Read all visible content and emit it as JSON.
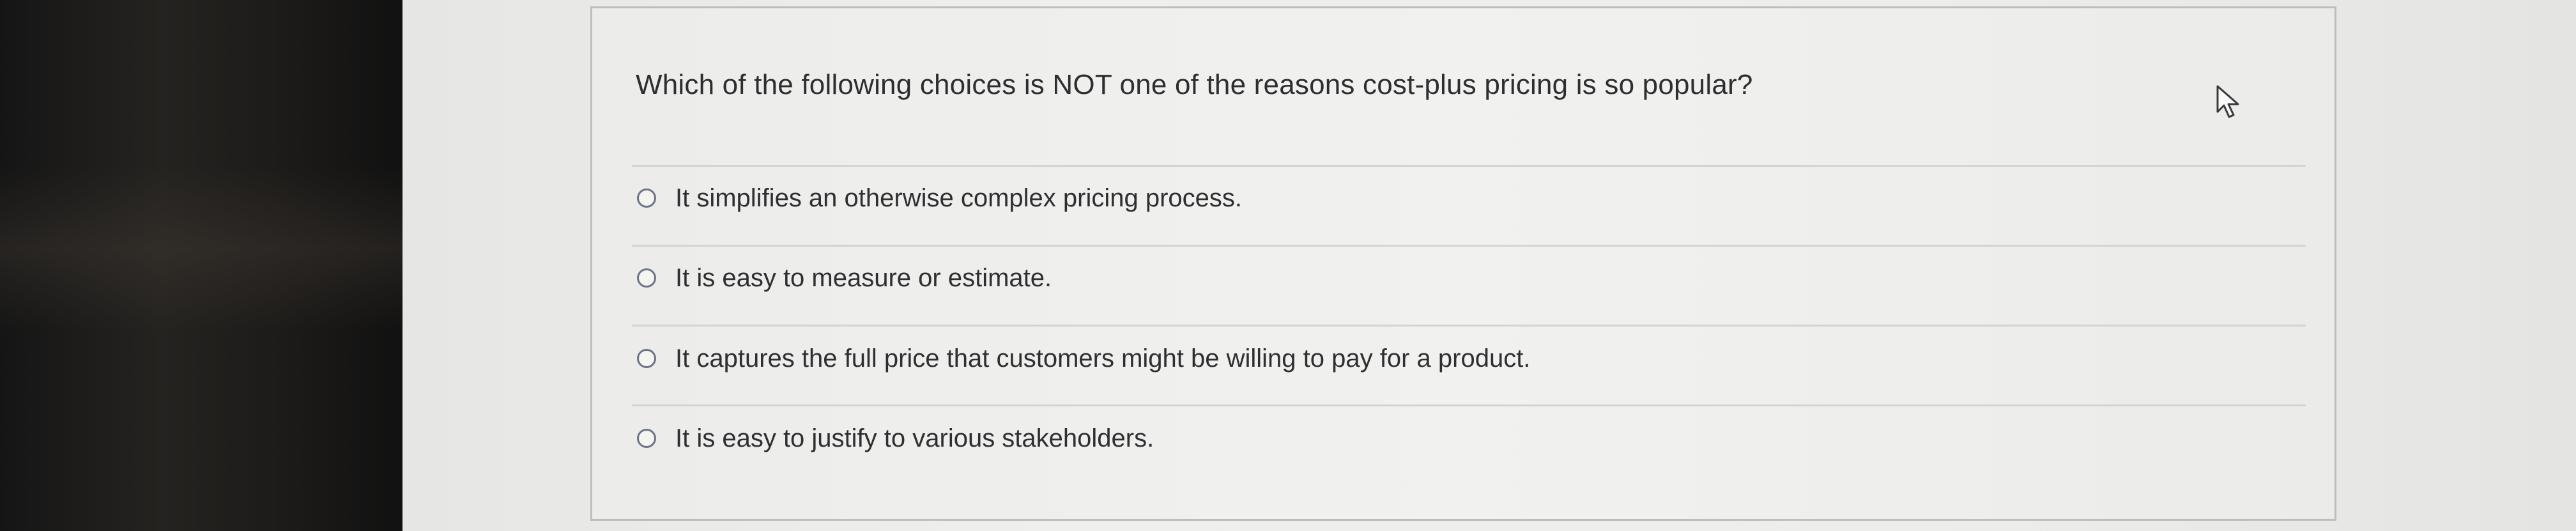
{
  "quiz": {
    "question": "Which of the following choices is NOT one of the reasons cost-plus pricing is so popular?",
    "options": [
      {
        "label": "It simplifies an otherwise complex pricing process."
      },
      {
        "label": "It is easy to measure or estimate."
      },
      {
        "label": "It captures the full price that customers might be willing to pay for a product."
      },
      {
        "label": "It is easy to justify to various stakeholders."
      }
    ]
  },
  "cursor": {
    "icon": "pointer-cursor-icon"
  }
}
